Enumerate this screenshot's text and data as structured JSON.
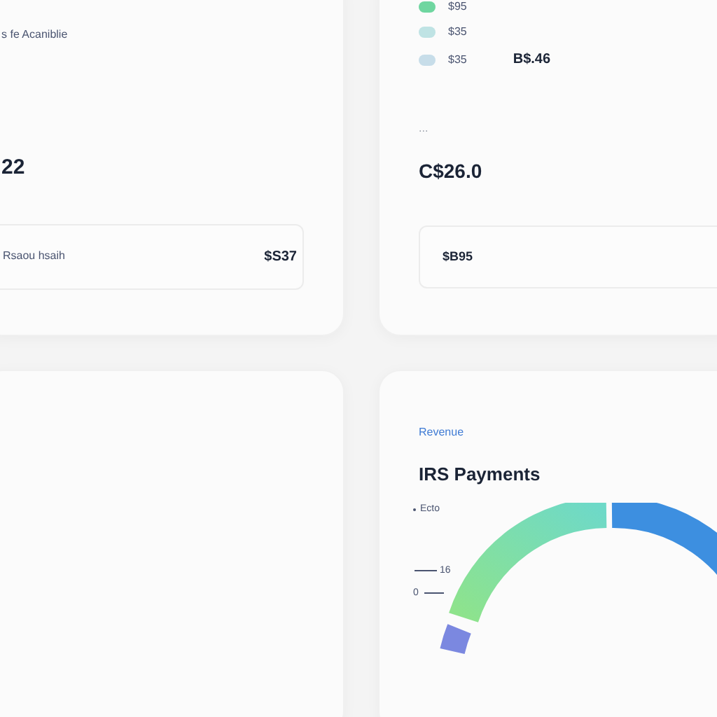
{
  "balance_card": {
    "label": "s fe Acaniblie",
    "value": "22",
    "row": {
      "label": "Rsaou hsaih",
      "amount": "$S37"
    }
  },
  "summary_card": {
    "legend": [
      {
        "label": "$95",
        "color": "#6fd6a0"
      },
      {
        "label": "$35",
        "color": "#bfe3e4"
      },
      {
        "label": "$35",
        "color": "#c7dde9"
      }
    ],
    "legend_total": "B$.46",
    "caption": "...",
    "value": "C$26.0",
    "row": {
      "amount": "$B95"
    }
  },
  "payments_card": {
    "eyebrow": "Revenue",
    "title": "IRS Payments",
    "series_label": "Ecto",
    "tick_labels": [
      "16",
      "0"
    ]
  }
}
